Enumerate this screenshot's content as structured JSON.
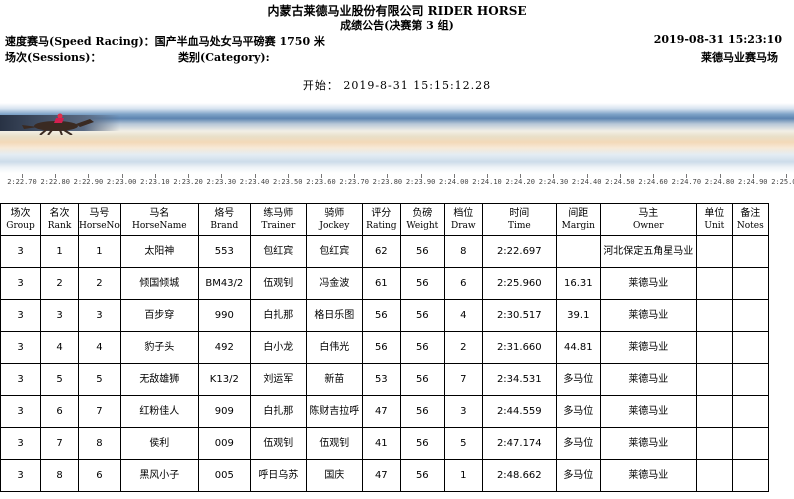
{
  "header": {
    "company": "内蒙古莱德马业股份有限公司 RIDER HORSE",
    "subtitle": "成绩公告(决赛第 3 组)",
    "race": "速度赛马(Speed Racing)：国产半血马处女马平磅赛 1750 米",
    "datetime": "2019-08-31    15:23:10",
    "session": "场次(Sessions)：",
    "category": "类别(Category):",
    "organizer": "莱德马业赛马场",
    "start": "开始：  2019-8-31  15:15:12.28"
  },
  "ticks": [
    "2:22.70",
    "2:22.80",
    "2:22.90",
    "2:23.00",
    "2:23.10",
    "2:23.20",
    "2:23.30",
    "2:23.40",
    "2:23.50",
    "2:23.60",
    "2:23.70",
    "2:23.80",
    "2:23.90",
    "2:24.00",
    "2:24.10",
    "2:24.20",
    "2:24.30",
    "2:24.40",
    "2:24.50",
    "2:24.60",
    "2:24.70",
    "2:24.80",
    "2:24.90",
    "2:25.00"
  ],
  "columns": [
    {
      "cn": "场次",
      "en": "Group"
    },
    {
      "cn": "名次",
      "en": "Rank"
    },
    {
      "cn": "马号",
      "en": "HorseNo"
    },
    {
      "cn": "马名",
      "en": "HorseName"
    },
    {
      "cn": "烙号",
      "en": "Brand"
    },
    {
      "cn": "练马师",
      "en": "Trainer"
    },
    {
      "cn": "骑师",
      "en": "Jockey"
    },
    {
      "cn": "评分",
      "en": "Rating"
    },
    {
      "cn": "负磅",
      "en": "Weight"
    },
    {
      "cn": "档位",
      "en": "Draw"
    },
    {
      "cn": "时间",
      "en": "Time"
    },
    {
      "cn": "间距",
      "en": "Margin"
    },
    {
      "cn": "马主",
      "en": "Owner"
    },
    {
      "cn": "单位",
      "en": "Unit"
    },
    {
      "cn": "备注",
      "en": "Notes"
    }
  ],
  "rows": [
    [
      "3",
      "1",
      "1",
      "太阳神",
      "553",
      "包红宾",
      "包红宾",
      "62",
      "56",
      "8",
      "2:22.697",
      "",
      "河北保定五角星马业",
      "",
      ""
    ],
    [
      "3",
      "2",
      "2",
      "倾国倾城",
      "BM43/2",
      "伍观钊",
      "冯金波",
      "61",
      "56",
      "6",
      "2:25.960",
      "16.31",
      "莱德马业",
      "",
      ""
    ],
    [
      "3",
      "3",
      "3",
      "百步穿",
      "990",
      "白扎那",
      "格日乐图",
      "56",
      "56",
      "4",
      "2:30.517",
      "39.1",
      "莱德马业",
      "",
      ""
    ],
    [
      "3",
      "4",
      "4",
      "豹子头",
      "492",
      "白小龙",
      "白伟光",
      "56",
      "56",
      "2",
      "2:31.660",
      "44.81",
      "莱德马业",
      "",
      ""
    ],
    [
      "3",
      "5",
      "5",
      "无敌雄狮",
      "K13/2",
      "刘运军",
      "新苗",
      "53",
      "56",
      "7",
      "2:34.531",
      "多马位",
      "莱德马业",
      "",
      ""
    ],
    [
      "3",
      "6",
      "7",
      "红粉佳人",
      "909",
      "白扎那",
      "陈财吉拉呼",
      "47",
      "56",
      "3",
      "2:44.559",
      "多马位",
      "莱德马业",
      "",
      ""
    ],
    [
      "3",
      "7",
      "8",
      "侯利",
      "009",
      "伍观钊",
      "伍观钊",
      "41",
      "56",
      "5",
      "2:47.174",
      "多马位",
      "莱德马业",
      "",
      ""
    ],
    [
      "3",
      "8",
      "6",
      "黑风小子",
      "005",
      "呼日乌苏",
      "国庆",
      "47",
      "56",
      "1",
      "2:48.662",
      "多马位",
      "莱德马业",
      "",
      ""
    ]
  ]
}
